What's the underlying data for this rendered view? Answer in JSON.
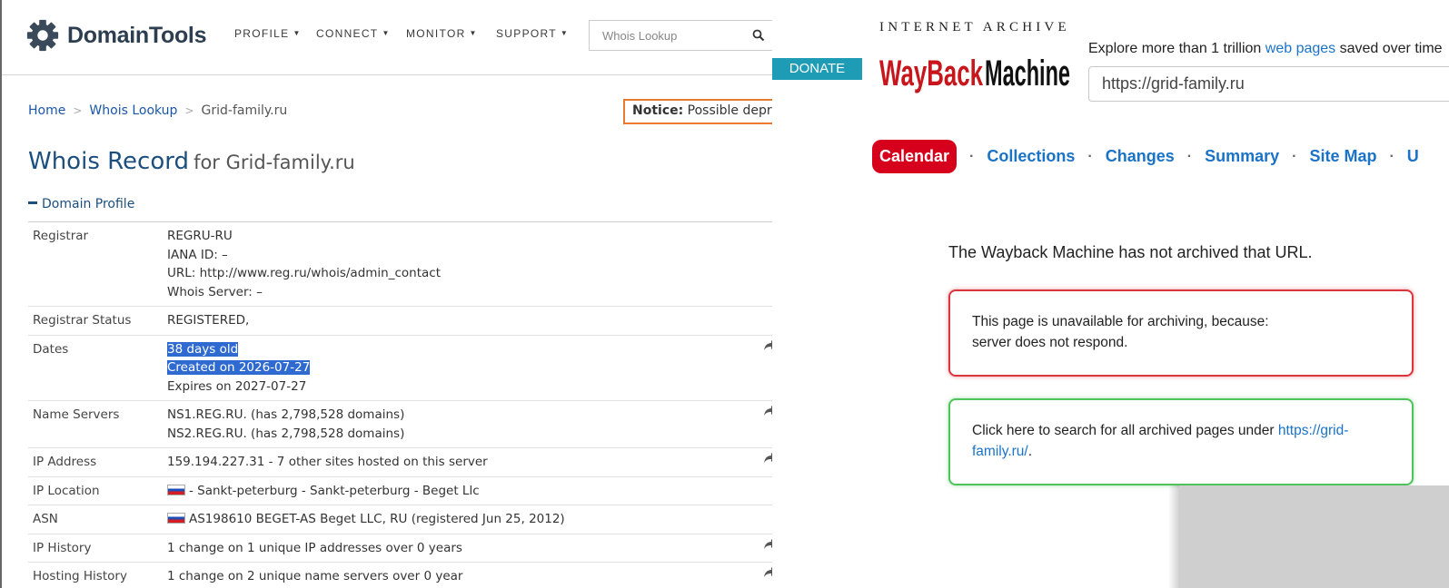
{
  "domaintools": {
    "logo_text": "DomainTools",
    "nav": [
      {
        "label": "PROFILE"
      },
      {
        "label": "CONNECT"
      },
      {
        "label": "MONITOR"
      },
      {
        "label": "SUPPORT"
      }
    ],
    "search_placeholder": "Whois Lookup",
    "breadcrumb": {
      "home": "Home",
      "whois": "Whois Lookup",
      "current": "Grid-family.ru"
    },
    "notice": {
      "label": "Notice:",
      "text": "Possible depre"
    },
    "title": {
      "main": "Whois Record",
      "sub": "for Grid-family.ru"
    },
    "section": "Domain Profile",
    "rows": [
      {
        "key": "Registrar",
        "lines": [
          "REGRU-RU",
          "IANA ID: –",
          "URL: http://www.reg.ru/whois/admin_contact",
          "Whois Server: –"
        ]
      },
      {
        "key": "Registrar Status",
        "lines": [
          "REGISTERED,"
        ]
      },
      {
        "key": "Dates",
        "lines": [
          "38 days old",
          "Created on 2026-07-27",
          "Expires on 2027-07-27"
        ]
      },
      {
        "key": "Name Servers",
        "lines": [
          "NS1.REG.RU. (has 2,798,528 domains)",
          "NS2.REG.RU. (has 2,798,528 domains)"
        ]
      },
      {
        "key": "IP Address",
        "lines": [
          "159.194.227.31 - 7 other sites hosted on this server"
        ]
      },
      {
        "key": "IP Location",
        "lines": [
          "- Sankt-peterburg - Sankt-peterburg - Beget Llc"
        ]
      },
      {
        "key": "ASN",
        "lines": [
          "AS198610 BEGET-AS Beget LLC, RU (registered Jun 25, 2012)"
        ]
      },
      {
        "key": "IP History",
        "lines": [
          "1 change on 1 unique IP addresses over 0 years"
        ]
      },
      {
        "key": "Hosting History",
        "lines": [
          "1 change on 2 unique name servers over 0 year"
        ]
      }
    ]
  },
  "wayback": {
    "donate": "DONATE",
    "ia_text": "INTERNET ARCHIVE",
    "logo_text": "WaybackMachine",
    "explore": {
      "before": "Explore more than 1 trillion ",
      "link": "web pages",
      "after": " saved over time"
    },
    "url_value": "https://grid-family.ru",
    "tabs": [
      "Calendar",
      "Collections",
      "Changes",
      "Summary",
      "Site Map",
      "U"
    ],
    "message": "The Wayback Machine has not archived that URL.",
    "unavailable": {
      "line1": "This page is unavailable for archiving, because:",
      "line2": "server does not respond."
    },
    "search": {
      "text": "Click here to search for all archived pages under ",
      "link": "https://grid-family.ru/",
      "after": "."
    }
  },
  "colors": {
    "dt_title": "#1c4f7e",
    "dt_link": "#1a56a8",
    "notice_border": "#e87b2d",
    "selection": "#2f6ad0",
    "wb_donate": "#1e9bb5",
    "wb_logo_red": "#c8161d",
    "wb_tab_active": "#d6001c",
    "wb_link": "#1a73c7",
    "wb_box_red": "#d9363e",
    "wb_box_green": "#4fc35b"
  }
}
